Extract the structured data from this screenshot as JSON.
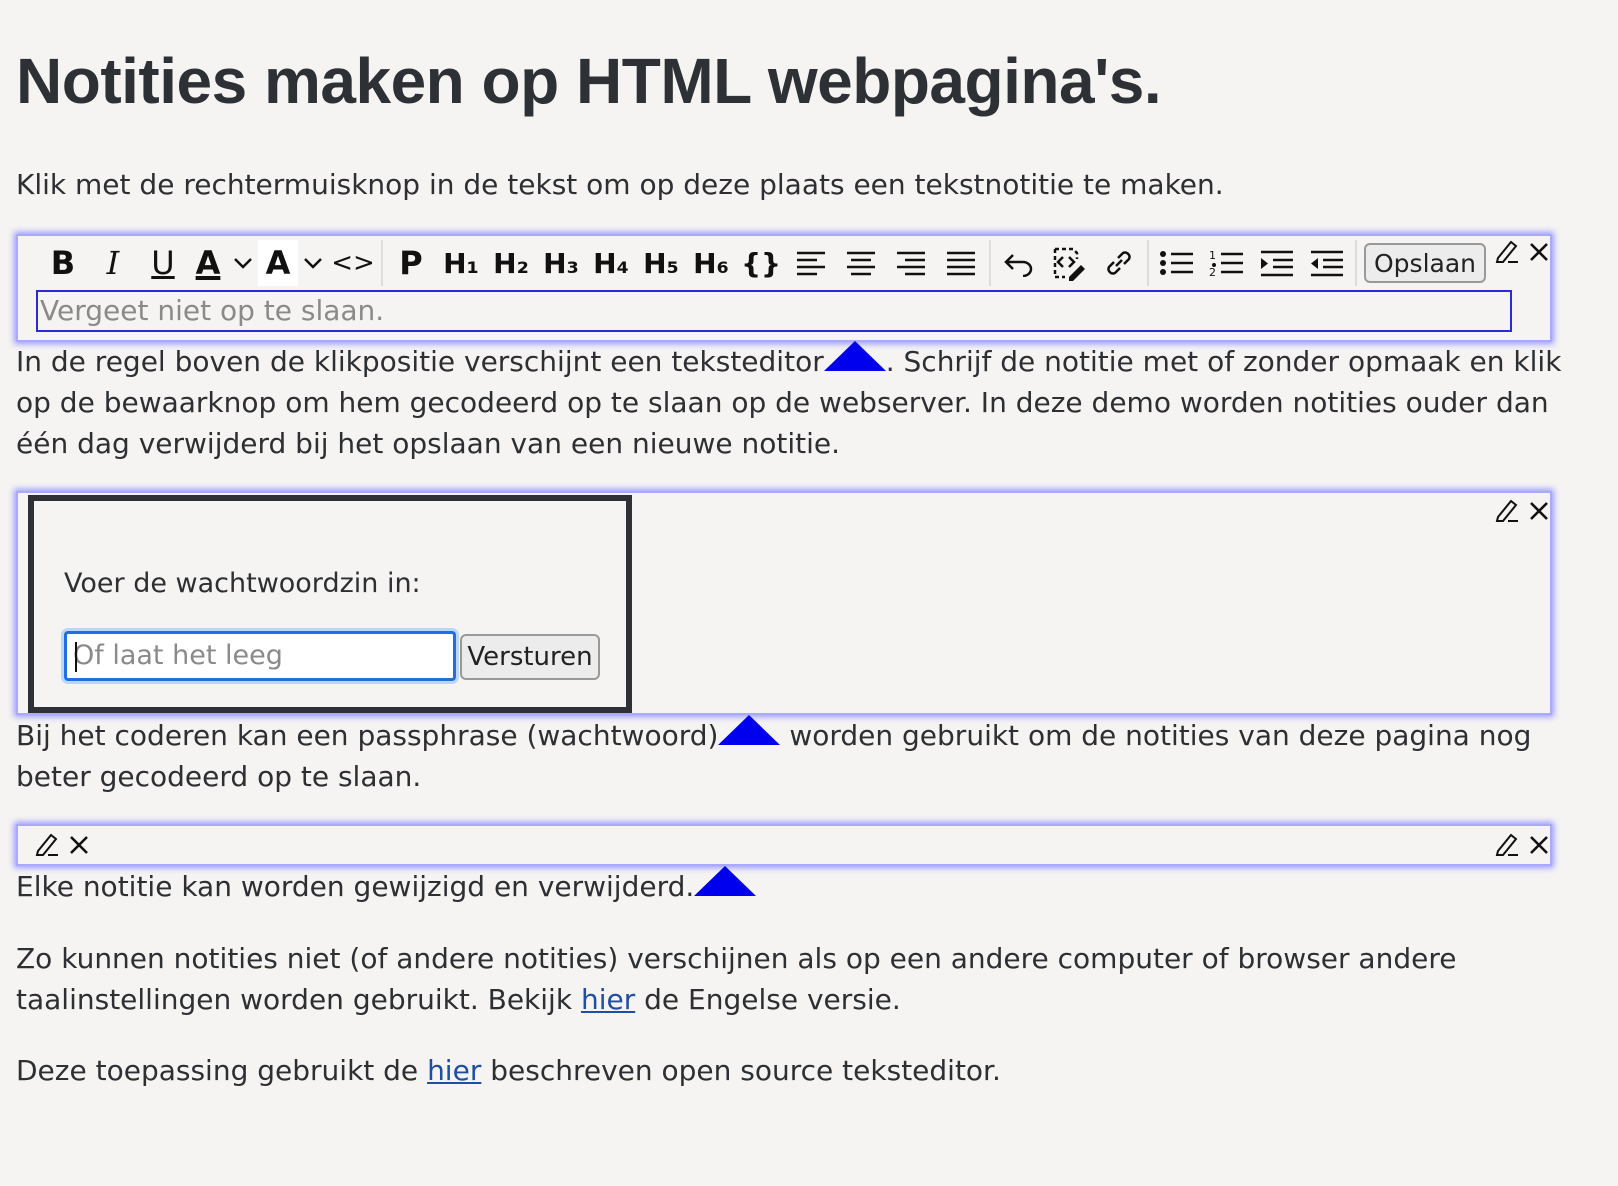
{
  "heading": "Notities maken op HTML webpagina's.",
  "intro": "Klik met de rechtermuisknop in de tekst om op deze plaats een tekstnotitie te maken.",
  "editor_note": {
    "toolbar": {
      "bold": "B",
      "italic": "I",
      "underline": "U",
      "font_color": "A",
      "highlight": "A",
      "code": "<>",
      "paragraph": "P",
      "h1": "H₁",
      "h2": "H₂",
      "h3": "H₃",
      "h4": "H₄",
      "h5": "H₅",
      "h6": "H₆",
      "code_block": "{}",
      "save_label": "Opslaan"
    },
    "placeholder": "Vergeet niet op te slaan."
  },
  "para1_before": "In de regel boven de klikpositie verschijnt een teksteditor",
  "para1_after": ". Schrijf de notitie met of zonder opmaak en klik op de bewaarknop om hem gecodeerd op te slaan op de webserver. In deze demo worden notities ouder dan één dag verwijderd bij het opslaan van een nieuwe notitie.",
  "password_dialog": {
    "label": "Voer de wachtwoordzin in:",
    "placeholder": "Of laat het leeg",
    "submit_label": "Versturen"
  },
  "para2_before": "Bij het coderen kan een passphrase (wachtwoord)",
  "para2_after": " worden gebruikt om de notities van deze pagina nog beter gecodeerd op te slaan.",
  "para3": "Elke notitie kan worden gewijzigd en verwijderd.",
  "para4_before": "Zo kunnen notities niet (of andere notities) verschijnen als op een andere computer of browser andere taalinstellingen worden gebruikt. Bekijk ",
  "para4_link": "hier",
  "para4_after": " de Engelse versie.",
  "para5_before": "Deze toepassing gebruikt de ",
  "para5_link": "hier",
  "para5_after": " beschreven open source teksteditor.",
  "colors": {
    "accent": "#0000ee",
    "note_border": "#a9a9ff",
    "link": "#1f4fa0"
  }
}
